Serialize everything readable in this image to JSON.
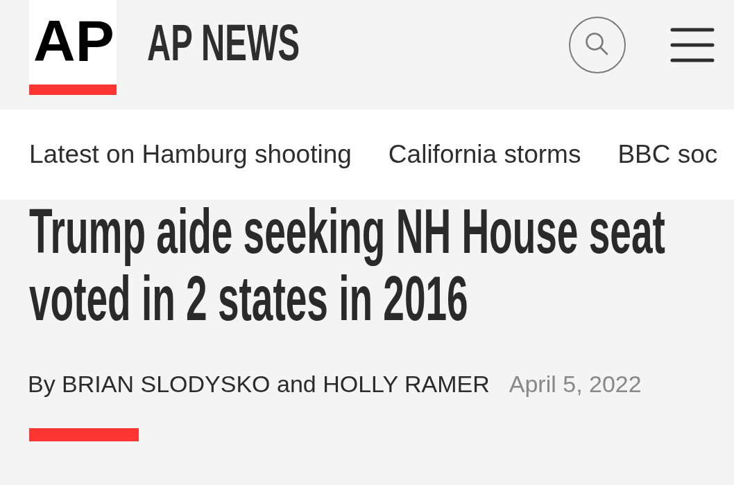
{
  "header": {
    "logo": "AP",
    "site_title": "AP NEWS"
  },
  "trending_nav": {
    "items": [
      "Latest on Hamburg shooting",
      "California storms",
      "BBC soc"
    ]
  },
  "article": {
    "headline": "Trump aide seeking NH House seat voted in 2 states in 2016",
    "byline": "By BRIAN SLODYSKO and HOLLY RAMER",
    "date": "April 5, 2022"
  }
}
